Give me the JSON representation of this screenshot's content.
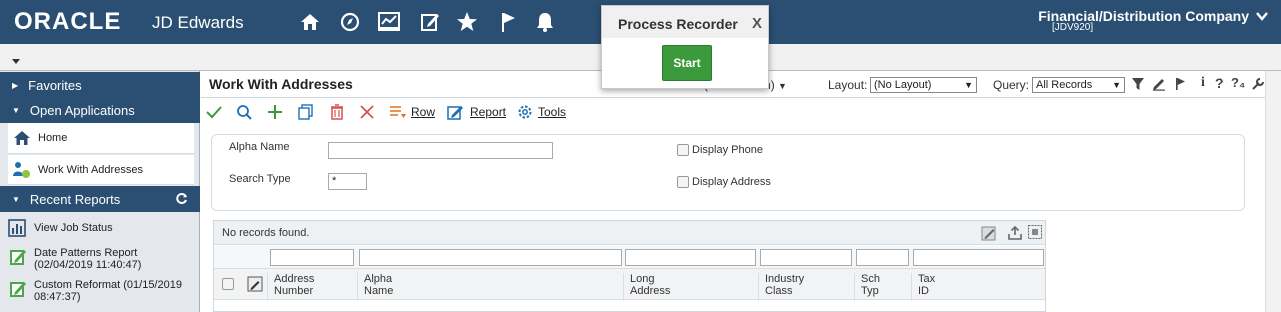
{
  "header": {
    "brand": "ORACLE",
    "product": "JD Edwards",
    "company": "Financial/Distribution Company",
    "environment": "[JDV920]",
    "icons": [
      "home-icon",
      "compass-icon",
      "chart-icon",
      "edit-icon",
      "star-icon",
      "flag-icon",
      "bell-icon"
    ]
  },
  "sidebar": {
    "favorites": "Favorites",
    "open_apps": "Open Applications",
    "open_items": [
      {
        "label": "Home",
        "icon": "home-icon"
      },
      {
        "label": "Work With Addresses",
        "icon": "people-icon"
      }
    ],
    "recent_reports": "Recent Reports",
    "reports": [
      {
        "label": "View Job Status",
        "icon": "chart-icon"
      },
      {
        "label": "Date Patterns Report",
        "sub": "(02/04/2019 11:40:47)",
        "icon": "edit-icon"
      },
      {
        "label": "Custom Reformat (01/15/2019",
        "sub": "08:47:37)",
        "icon": "edit-icon"
      }
    ]
  },
  "form": {
    "title": "Work With Addresses",
    "personalization_label": "(…nalization)",
    "layout_label": "Layout:",
    "layout_value": "(No Layout)",
    "query_label": "Query:",
    "query_value": "All Records",
    "toolbar": {
      "row": "Row",
      "report": "Report",
      "tools": "Tools"
    },
    "criteria": {
      "alpha_name_label": "Alpha Name",
      "alpha_name_value": "",
      "search_type_label": "Search Type",
      "search_type_value": "*",
      "display_phone": "Display Phone",
      "display_address": "Display Address"
    },
    "grid": {
      "status": "No records found.",
      "columns": [
        {
          "line1": "Address",
          "line2": "Number"
        },
        {
          "line1": "Alpha",
          "line2": "Name"
        },
        {
          "line1": "Long",
          "line2": "Address"
        },
        {
          "line1": "Industry",
          "line2": "Class"
        },
        {
          "line1": "Sch",
          "line2": "Typ"
        },
        {
          "line1": "Tax",
          "line2": "ID"
        }
      ]
    }
  },
  "popup": {
    "title": "Process Recorder",
    "close": "X",
    "start": "Start"
  },
  "colors": {
    "header_bg": "#2a4f73",
    "start_green": "#3b9a3b",
    "accent_blue": "#1f6fb5"
  }
}
